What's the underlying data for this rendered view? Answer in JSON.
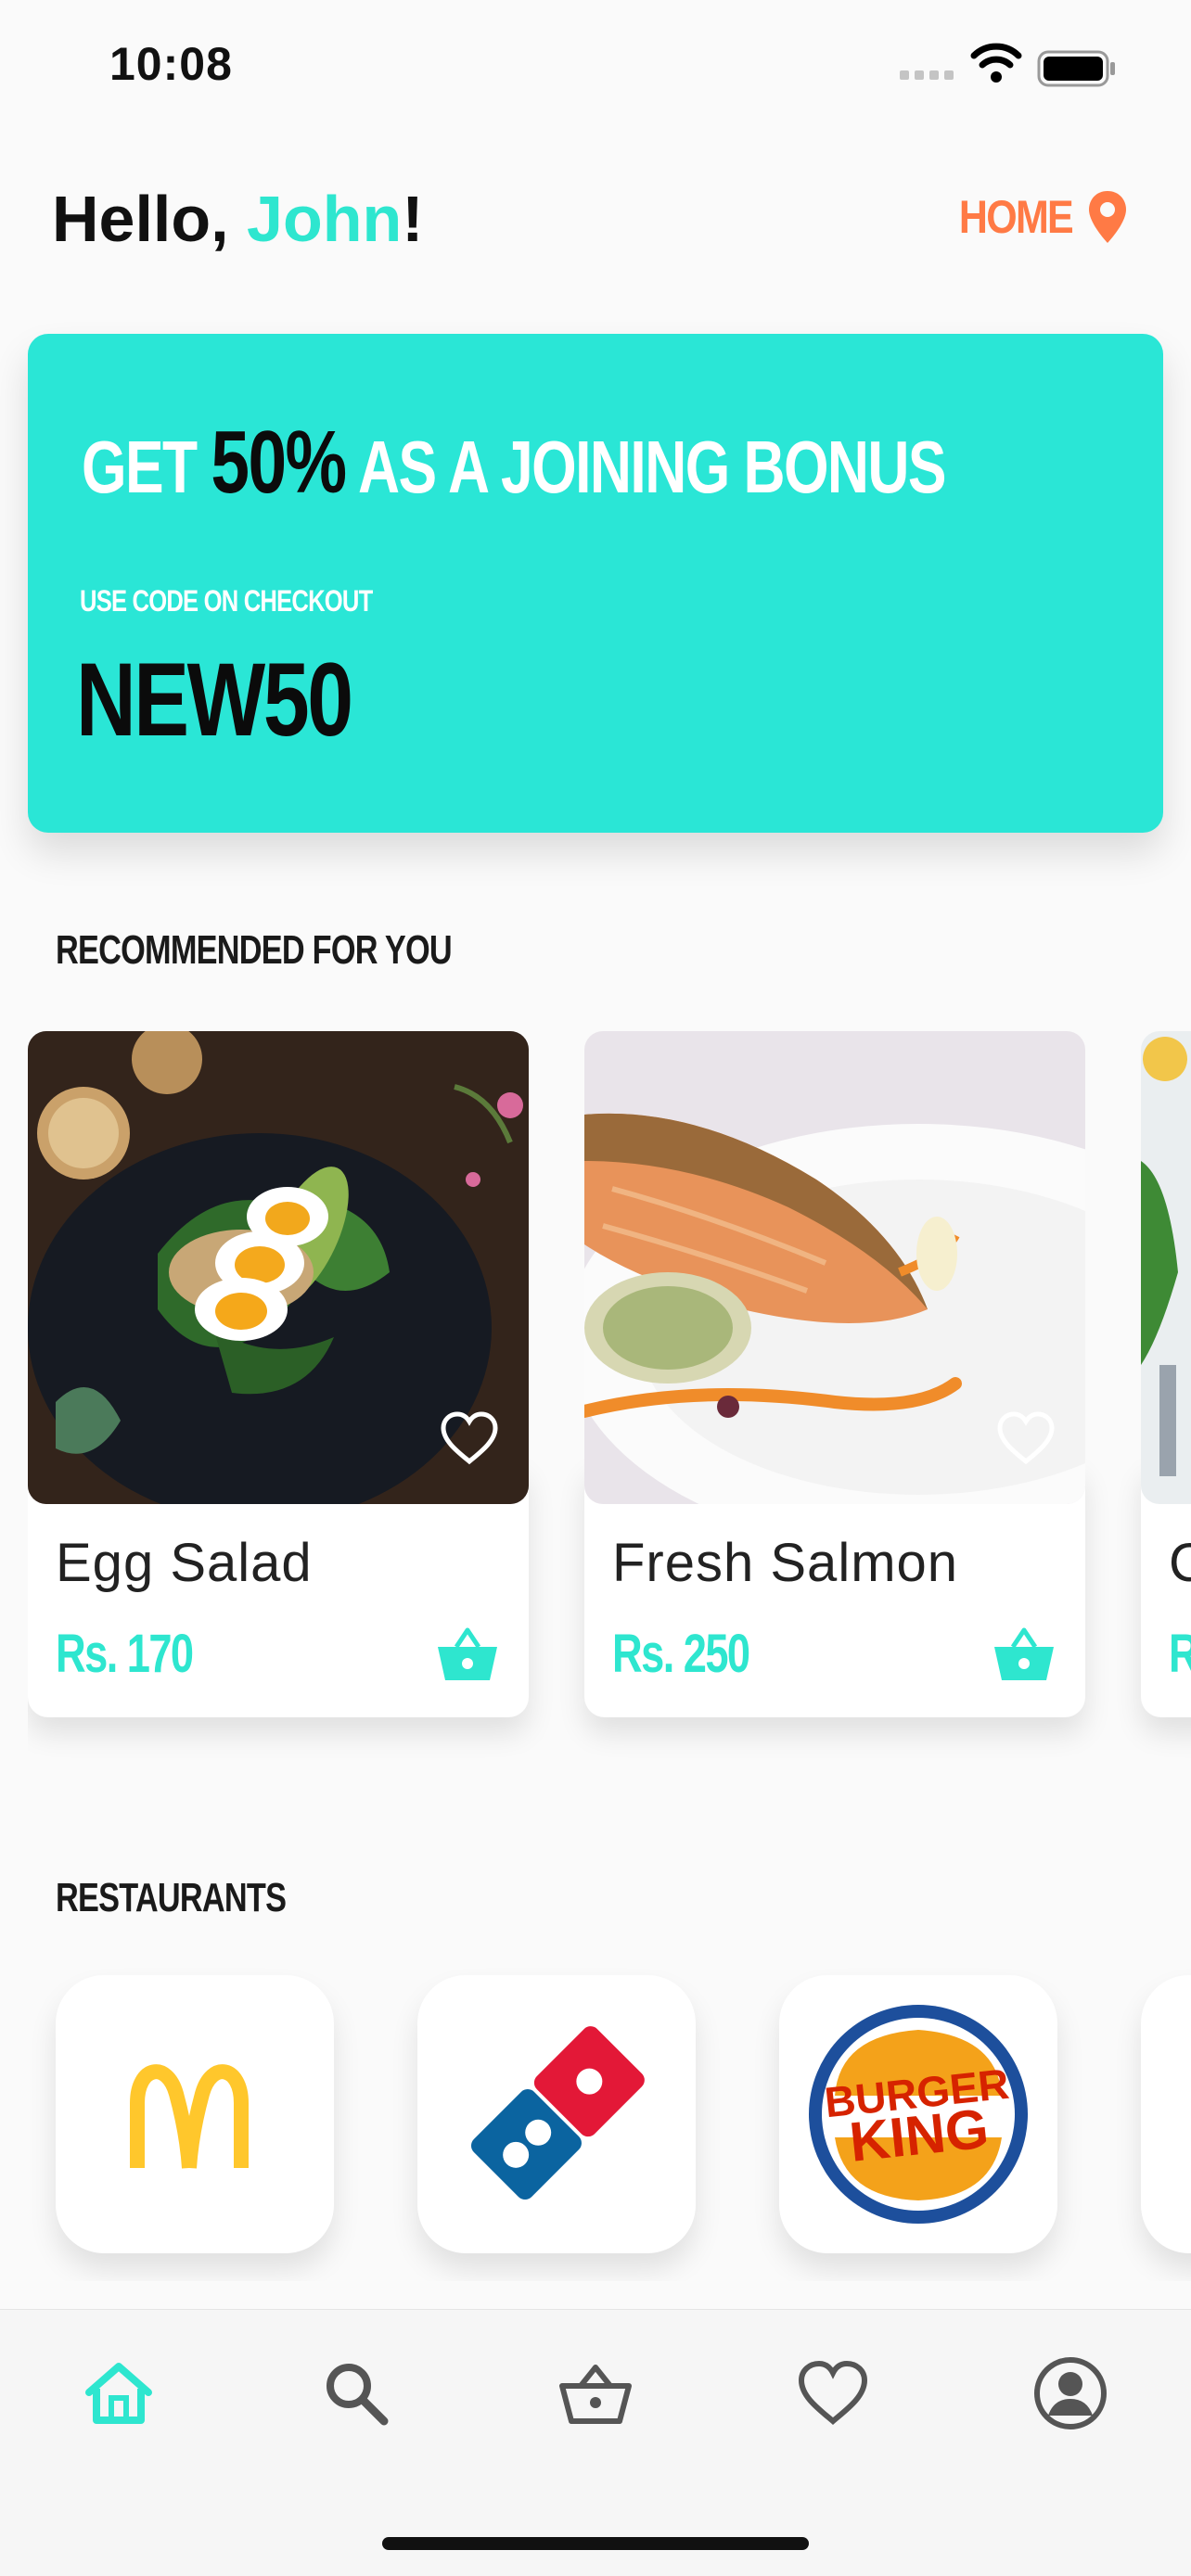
{
  "status_bar": {
    "time": "10:08"
  },
  "header": {
    "greeting": "Hello, ",
    "user_name": "John",
    "exclaim": "!",
    "location_label": "HOME"
  },
  "promo": {
    "line_pre": "GET ",
    "percent": "50%",
    "line_post": " AS A JOINING BONUS",
    "subtitle": "USE CODE ON CHECKOUT",
    "code": "NEW50",
    "bg_color": "#2ae6d6"
  },
  "recommended": {
    "title": "RECOMMENDED FOR YOU",
    "items": [
      {
        "name": "Egg Salad",
        "price": "Rs. 170"
      },
      {
        "name": "Fresh Salmon",
        "price": "Rs. 250"
      },
      {
        "name": "C",
        "price": "R"
      }
    ]
  },
  "restaurants": {
    "title": "RESTAURANTS",
    "items": [
      {
        "logo": "mcdonalds-logo"
      },
      {
        "logo": "dominos-logo"
      },
      {
        "logo": "burger-king-logo",
        "logo_text_1": "BURGER",
        "logo_text_2": "KING"
      }
    ]
  },
  "tabbar": {
    "items": [
      {
        "icon": "home-icon",
        "active": true
      },
      {
        "icon": "search-icon"
      },
      {
        "icon": "basket-icon"
      },
      {
        "icon": "heart-icon"
      },
      {
        "icon": "profile-icon"
      }
    ]
  },
  "colors": {
    "accent": "#2ee6cf",
    "location": "#ff7a45",
    "text": "#111111"
  }
}
